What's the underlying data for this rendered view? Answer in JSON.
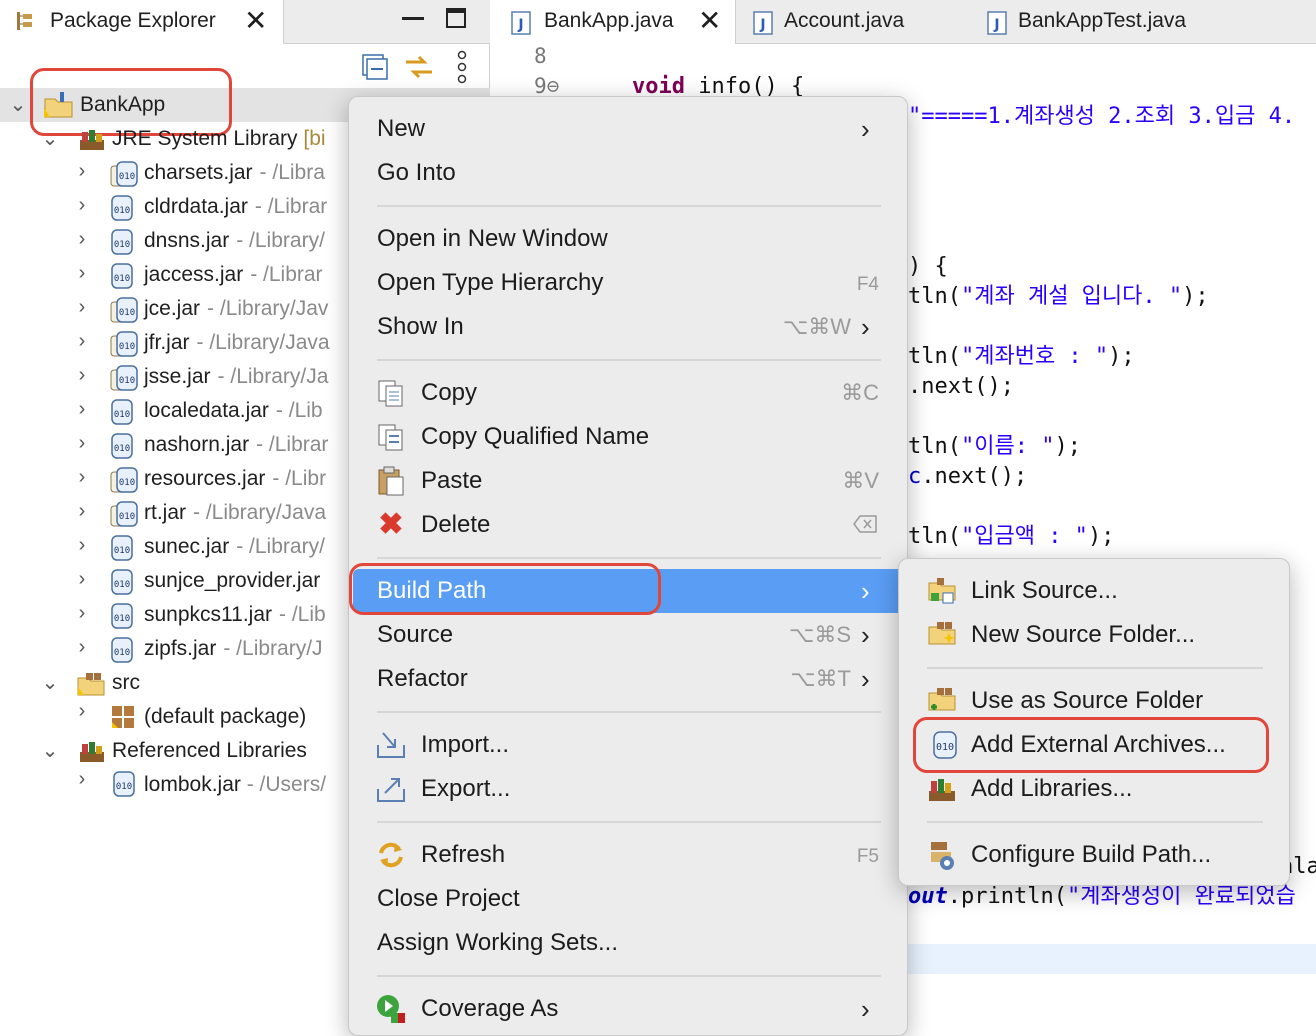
{
  "explorer": {
    "tab_label": "Package Explorer",
    "project": "BankApp",
    "jre": {
      "label": "JRE System Library",
      "suffix": "[bi"
    },
    "jars": [
      {
        "name": "charsets.jar",
        "path": "- /Libra"
      },
      {
        "name": "cldrdata.jar",
        "path": "- /Librar"
      },
      {
        "name": "dnsns.jar",
        "path": "- /Library/"
      },
      {
        "name": "jaccess.jar",
        "path": "- /Librar"
      },
      {
        "name": "jce.jar",
        "path": "- /Library/Jav"
      },
      {
        "name": "jfr.jar",
        "path": "- /Library/Java"
      },
      {
        "name": "jsse.jar",
        "path": "- /Library/Ja"
      },
      {
        "name": "localedata.jar",
        "path": "- /Lib"
      },
      {
        "name": "nashorn.jar",
        "path": "- /Librar"
      },
      {
        "name": "resources.jar",
        "path": "- /Libr"
      },
      {
        "name": "rt.jar",
        "path": "- /Library/Java"
      },
      {
        "name": "sunec.jar",
        "path": "- /Library/"
      },
      {
        "name": "sunjce_provider.jar",
        "path": ""
      },
      {
        "name": "sunpkcs11.jar",
        "path": "- /Lib"
      },
      {
        "name": "zipfs.jar",
        "path": "- /Library/J"
      }
    ],
    "src": "src",
    "default_package": "(default package)",
    "ref_libs": "Referenced Libraries",
    "lombok": {
      "name": "lombok.jar",
      "path": "- /Users/"
    }
  },
  "editor": {
    "tabs": [
      "BankApp.java",
      "Account.java",
      "BankAppTest.java"
    ],
    "line_numbers": [
      "8",
      "9⊖"
    ],
    "code": {
      "l9_kw": "void",
      "l9_rest": " info() {",
      "menu_str": "\"=====1.계좌생성 2.조회 3.입금 4.",
      "brace": ") {",
      "pre1": "tln(",
      "s1": "\"계좌 계설 입니다. \"",
      "end1": ");",
      "pre2": "tln(",
      "s2": "\"계좌번호 : \"",
      "end2": ");",
      "next1": ".next();",
      "pre3": "tln(",
      "s3": "\"이름: \"",
      "end3": ");",
      "next2_c": "c",
      "next2": ".next();",
      "pre4": "tln(",
      "s4": "\"입금액 : \"",
      "end4": ");",
      "tail_ala": "ala",
      "out_kw": "out",
      "out_rest": ".println(",
      "s5": "\"계좌생성이 완료되었습"
    }
  },
  "context_menu": {
    "items": {
      "new": "New",
      "go_into": "Go Into",
      "open_window": "Open in New Window",
      "open_type_hierarchy": "Open Type Hierarchy",
      "open_type_hierarchy_sc": "F4",
      "show_in": "Show In",
      "show_in_sc": "⌥⌘W",
      "copy": "Copy",
      "copy_sc": "⌘C",
      "copy_qn": "Copy Qualified Name",
      "paste": "Paste",
      "paste_sc": "⌘V",
      "delete": "Delete",
      "build_path": "Build Path",
      "source": "Source",
      "source_sc": "⌥⌘S",
      "refactor": "Refactor",
      "refactor_sc": "⌥⌘T",
      "import": "Import...",
      "export": "Export...",
      "refresh": "Refresh",
      "refresh_sc": "F5",
      "close_project": "Close Project",
      "assign_ws": "Assign Working Sets...",
      "coverage": "Coverage As"
    }
  },
  "submenu": {
    "link_source": "Link Source...",
    "new_source_folder": "New Source Folder...",
    "use_as_source": "Use as Source Folder",
    "add_external_archives": "Add External Archives...",
    "add_libraries": "Add Libraries...",
    "configure_build_path": "Configure Build Path..."
  },
  "colors": {
    "selection": "#5a9df5",
    "highlight": "#e0463a",
    "string": "#2a00ff",
    "keyword": "#7f0055"
  }
}
